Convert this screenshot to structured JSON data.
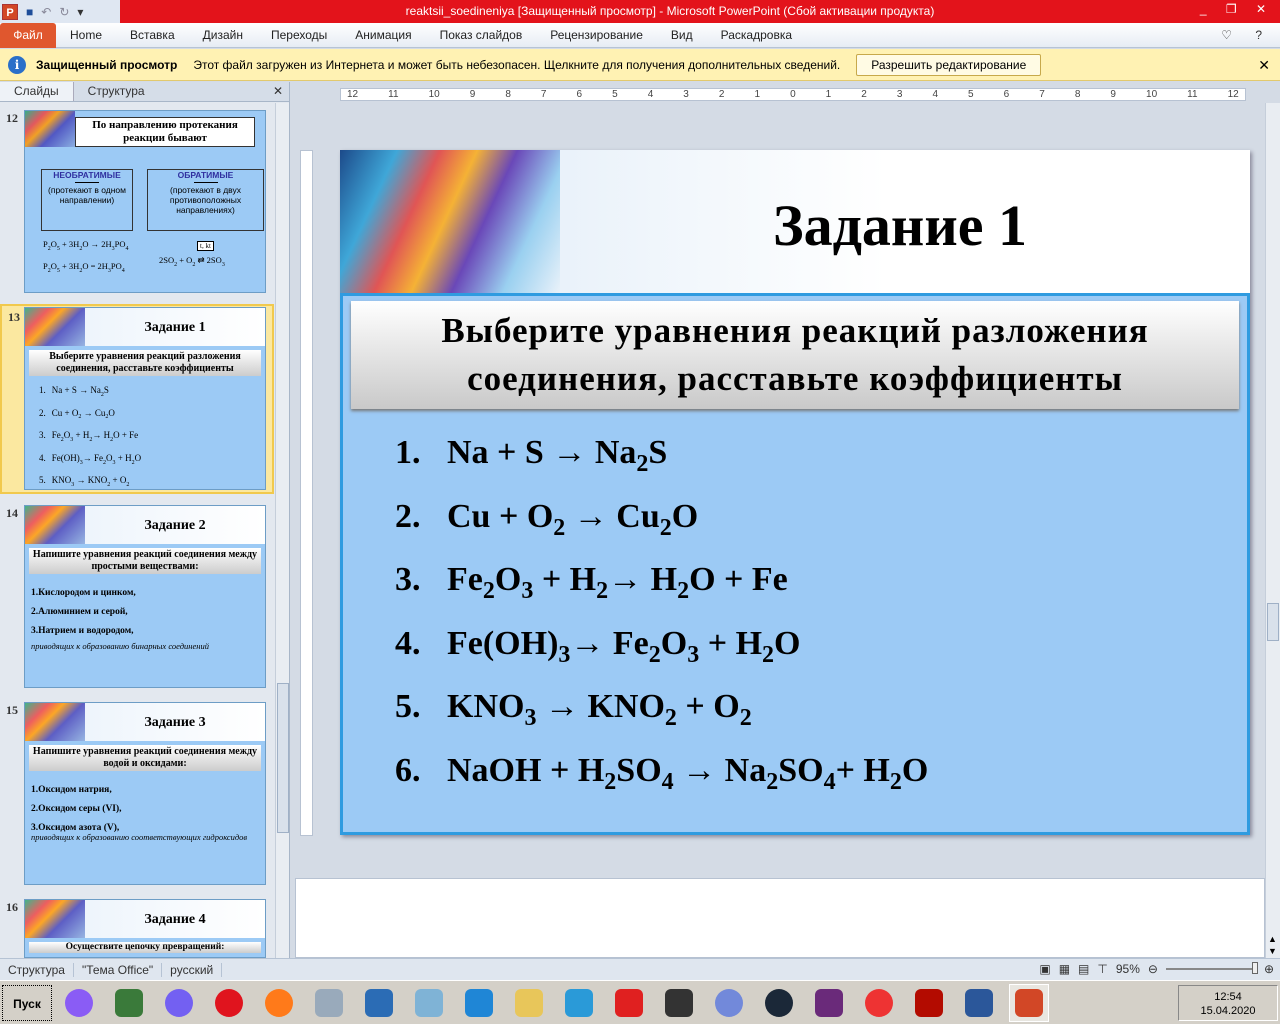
{
  "window": {
    "title": "reaktsii_soedineniya [Защищенный просмотр]  -  Microsoft PowerPoint (Сбой активации продукта)",
    "controls": "_ ❐ ✕"
  },
  "ribbon": {
    "file": "Файл",
    "tabs": [
      "Home",
      "Вставка",
      "Дизайн",
      "Переходы",
      "Анимация",
      "Показ слайдов",
      "Рецензирование",
      "Вид",
      "Раскадровка"
    ],
    "right_icons": "♡ ?"
  },
  "protected": {
    "title": "Защищенный просмотр",
    "message": "Этот файл загружен из Интернета и может быть небезопасен. Щелкните для получения дополнительных сведений.",
    "button": "Разрешить редактирование",
    "close": "✕"
  },
  "panel": {
    "tabs": [
      "Слайды",
      "Структура"
    ],
    "close": "✕"
  },
  "thumbs": {
    "s12": {
      "num": "12",
      "title": "По направлению протекания реакции бывают",
      "left": "НЕОБРАТИМЫЕ",
      "left_sub": "(протекают в одном направлении)",
      "right": "ОБРАТИМЫЕ",
      "right_sub": "(протекают в двух противоположных направлениях)",
      "eq1": "P_2O_5 + 3H_2O → 2H_3PO_4",
      "eq2": "P_2O_5 + 3H_2O = 2H_3PO_4",
      "cond": "t, kt",
      "eq3": "2SO_2 + O_2 ⇄ 2SO_3"
    },
    "s13": {
      "num": "13",
      "title": "Задание 1",
      "task": "Выберите уравнения реакций разложения соединения, расставьте коэффициенты"
    },
    "s14": {
      "num": "14",
      "title": "Задание 2",
      "task": "Напишите уравнения реакций соединения между простыми веществами:",
      "lines": [
        "1.Кислородом и цинком,",
        "2.Алюминием и серой,",
        "3.Натрием и водородом,"
      ],
      "note": "приводящих к образованию бинарных соединений"
    },
    "s15": {
      "num": "15",
      "title": "Задание 3",
      "task": "Напишите уравнения реакций соединения между водой и оксидами:",
      "lines": [
        "1.Оксидом натрия,",
        "2.Оксидом серы (VI),",
        "3.Оксидом азота (V),"
      ],
      "note": "приводящих к образованию соответствующих гидроксидов"
    },
    "s16": {
      "num": "16",
      "title": "Задание 4",
      "task": "Осуществите цепочку превращений:"
    }
  },
  "ruler": [
    "12",
    "11",
    "10",
    "9",
    "8",
    "7",
    "6",
    "5",
    "4",
    "3",
    "2",
    "1",
    "0",
    "1",
    "2",
    "3",
    "4",
    "5",
    "6",
    "7",
    "8",
    "9",
    "10",
    "11",
    "12"
  ],
  "slide": {
    "title": "Задание 1",
    "task_line1": "Выберите уравнения реакций разложения",
    "task_line2": "соединения, расставьте коэффициенты",
    "equations": [
      {
        "n": "1.",
        "eq": "Na +  S →  Na_2S"
      },
      {
        "n": "2.",
        "eq": "Cu +  O_2 →  Cu_2O"
      },
      {
        "n": "3.",
        "eq": "Fe_2O_3 +  H_2→  H_2O +  Fe"
      },
      {
        "n": "4.",
        "eq": "Fe(OH)_3→  Fe_2O_3 +  H_2O"
      },
      {
        "n": "5.",
        "eq": "KNO_3 →  KNO_2 +  O_2"
      },
      {
        "n": "6.",
        "eq": "NaOH +  H_2SO_4 →  Na_2SO_4+  H_2O"
      }
    ]
  },
  "status": {
    "view": "Структура",
    "theme": "\"Тема Office\"",
    "lang": "русский",
    "zoom": "95%"
  },
  "taskbar": {
    "start": "Пуск",
    "time": "12:54",
    "date": "15.04.2020",
    "apps": [
      {
        "name": "alice",
        "color": "#8a5cf5"
      },
      {
        "name": "task-manager",
        "color": "#3a7a3a"
      },
      {
        "name": "viber",
        "color": "#7360f2"
      },
      {
        "name": "opera",
        "color": "#e0141e"
      },
      {
        "name": "firefox",
        "color": "#ff7a1a"
      },
      {
        "name": "package",
        "color": "#9ab"
      },
      {
        "name": "wps-writer",
        "color": "#2b6cb5"
      },
      {
        "name": "notepad",
        "color": "#7fb3d6"
      },
      {
        "name": "internet-explorer",
        "color": "#1f86d6"
      },
      {
        "name": "file-explorer",
        "color": "#e8c65a"
      },
      {
        "name": "media-player",
        "color": "#2a9ad8"
      },
      {
        "name": "yandex",
        "color": "#e02020"
      },
      {
        "name": "zona",
        "color": "#333"
      },
      {
        "name": "discord",
        "color": "#7289da"
      },
      {
        "name": "steam",
        "color": "#1b2838"
      },
      {
        "name": "game-app",
        "color": "#6a2a7a"
      },
      {
        "name": "yandex-browser",
        "color": "#e33"
      },
      {
        "name": "acrobat",
        "color": "#b30b00"
      },
      {
        "name": "word",
        "color": "#2b579a"
      },
      {
        "name": "powerpoint",
        "color": "#d24726"
      }
    ]
  }
}
